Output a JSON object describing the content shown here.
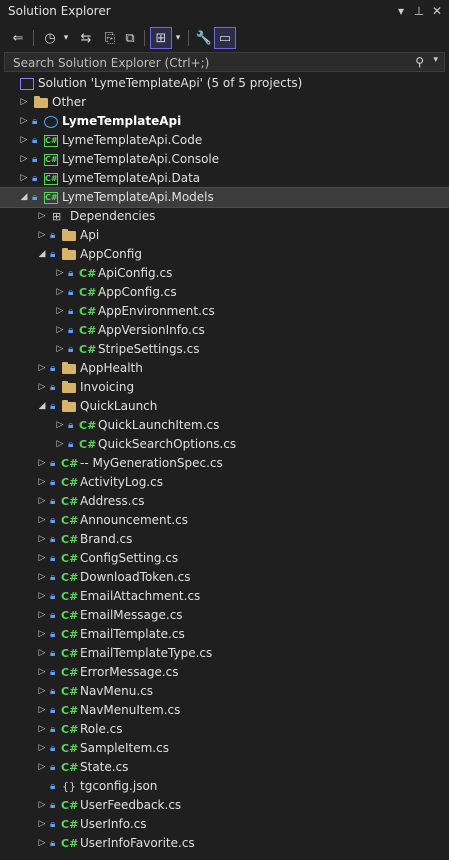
{
  "window": {
    "title": "Solution Explorer"
  },
  "search": {
    "placeholder": "Search Solution Explorer (Ctrl+;)"
  },
  "tree": [
    {
      "depth": 0,
      "kind": "solution",
      "label": "Solution 'LymeTemplateApi' (5 of 5 projects)",
      "arrow": "none"
    },
    {
      "depth": 1,
      "kind": "folder",
      "label": "Other",
      "arrow": "closed"
    },
    {
      "depth": 1,
      "kind": "web",
      "label": "LymeTemplateApi",
      "arrow": "closed",
      "lock": true,
      "bold": true
    },
    {
      "depth": 1,
      "kind": "project",
      "label": "LymeTemplateApi.Code",
      "arrow": "closed",
      "lock": true
    },
    {
      "depth": 1,
      "kind": "project",
      "label": "LymeTemplateApi.Console",
      "arrow": "closed",
      "lock": true
    },
    {
      "depth": 1,
      "kind": "project",
      "label": "LymeTemplateApi.Data",
      "arrow": "closed",
      "lock": true
    },
    {
      "depth": 1,
      "kind": "project",
      "label": "LymeTemplateApi.Models",
      "arrow": "open",
      "lock": true,
      "selected": true
    },
    {
      "depth": 2,
      "kind": "deps",
      "label": "Dependencies",
      "arrow": "closed"
    },
    {
      "depth": 2,
      "kind": "folder",
      "label": "Api",
      "arrow": "closed",
      "lock": true
    },
    {
      "depth": 2,
      "kind": "folder",
      "label": "AppConfig",
      "arrow": "open",
      "lock": true
    },
    {
      "depth": 3,
      "kind": "cs",
      "label": "ApiConfig.cs",
      "arrow": "closed",
      "lock": true
    },
    {
      "depth": 3,
      "kind": "cs",
      "label": "AppConfig.cs",
      "arrow": "closed",
      "lock": true
    },
    {
      "depth": 3,
      "kind": "cs",
      "label": "AppEnvironment.cs",
      "arrow": "closed",
      "lock": true
    },
    {
      "depth": 3,
      "kind": "cs",
      "label": "AppVersionInfo.cs",
      "arrow": "closed",
      "lock": true
    },
    {
      "depth": 3,
      "kind": "cs",
      "label": "StripeSettings.cs",
      "arrow": "closed",
      "lock": true
    },
    {
      "depth": 2,
      "kind": "folder",
      "label": "AppHealth",
      "arrow": "closed",
      "lock": true
    },
    {
      "depth": 2,
      "kind": "folder",
      "label": "Invoicing",
      "arrow": "closed",
      "lock": true
    },
    {
      "depth": 2,
      "kind": "folder",
      "label": "QuickLaunch",
      "arrow": "open",
      "lock": true
    },
    {
      "depth": 3,
      "kind": "cs",
      "label": "QuickLaunchItem.cs",
      "arrow": "closed",
      "lock": true
    },
    {
      "depth": 3,
      "kind": "cs",
      "label": "QuickSearchOptions.cs",
      "arrow": "closed",
      "lock": true
    },
    {
      "depth": 2,
      "kind": "cs",
      "label": "-- MyGenerationSpec.cs",
      "arrow": "closed",
      "lock": true
    },
    {
      "depth": 2,
      "kind": "cs",
      "label": "ActivityLog.cs",
      "arrow": "closed",
      "lock": true
    },
    {
      "depth": 2,
      "kind": "cs",
      "label": "Address.cs",
      "arrow": "closed",
      "lock": true
    },
    {
      "depth": 2,
      "kind": "cs",
      "label": "Announcement.cs",
      "arrow": "closed",
      "lock": true
    },
    {
      "depth": 2,
      "kind": "cs",
      "label": "Brand.cs",
      "arrow": "closed",
      "lock": true
    },
    {
      "depth": 2,
      "kind": "cs",
      "label": "ConfigSetting.cs",
      "arrow": "closed",
      "lock": true
    },
    {
      "depth": 2,
      "kind": "cs",
      "label": "DownloadToken.cs",
      "arrow": "closed",
      "lock": true
    },
    {
      "depth": 2,
      "kind": "cs",
      "label": "EmailAttachment.cs",
      "arrow": "closed",
      "lock": true
    },
    {
      "depth": 2,
      "kind": "cs",
      "label": "EmailMessage.cs",
      "arrow": "closed",
      "lock": true
    },
    {
      "depth": 2,
      "kind": "cs",
      "label": "EmailTemplate.cs",
      "arrow": "closed",
      "lock": true
    },
    {
      "depth": 2,
      "kind": "cs",
      "label": "EmailTemplateType.cs",
      "arrow": "closed",
      "lock": true
    },
    {
      "depth": 2,
      "kind": "cs",
      "label": "ErrorMessage.cs",
      "arrow": "closed",
      "lock": true
    },
    {
      "depth": 2,
      "kind": "cs",
      "label": "NavMenu.cs",
      "arrow": "closed",
      "lock": true
    },
    {
      "depth": 2,
      "kind": "cs",
      "label": "NavMenuItem.cs",
      "arrow": "closed",
      "lock": true
    },
    {
      "depth": 2,
      "kind": "cs",
      "label": "Role.cs",
      "arrow": "closed",
      "lock": true
    },
    {
      "depth": 2,
      "kind": "cs",
      "label": "SampleItem.cs",
      "arrow": "closed",
      "lock": true
    },
    {
      "depth": 2,
      "kind": "cs",
      "label": "State.cs",
      "arrow": "closed",
      "lock": true
    },
    {
      "depth": 2,
      "kind": "json",
      "label": "tgconfig.json",
      "arrow": "none",
      "lock": true
    },
    {
      "depth": 2,
      "kind": "cs",
      "label": "UserFeedback.cs",
      "arrow": "closed",
      "lock": true
    },
    {
      "depth": 2,
      "kind": "cs",
      "label": "UserInfo.cs",
      "arrow": "closed",
      "lock": true
    },
    {
      "depth": 2,
      "kind": "cs",
      "label": "UserInfoFavorite.cs",
      "arrow": "closed",
      "lock": true
    }
  ]
}
